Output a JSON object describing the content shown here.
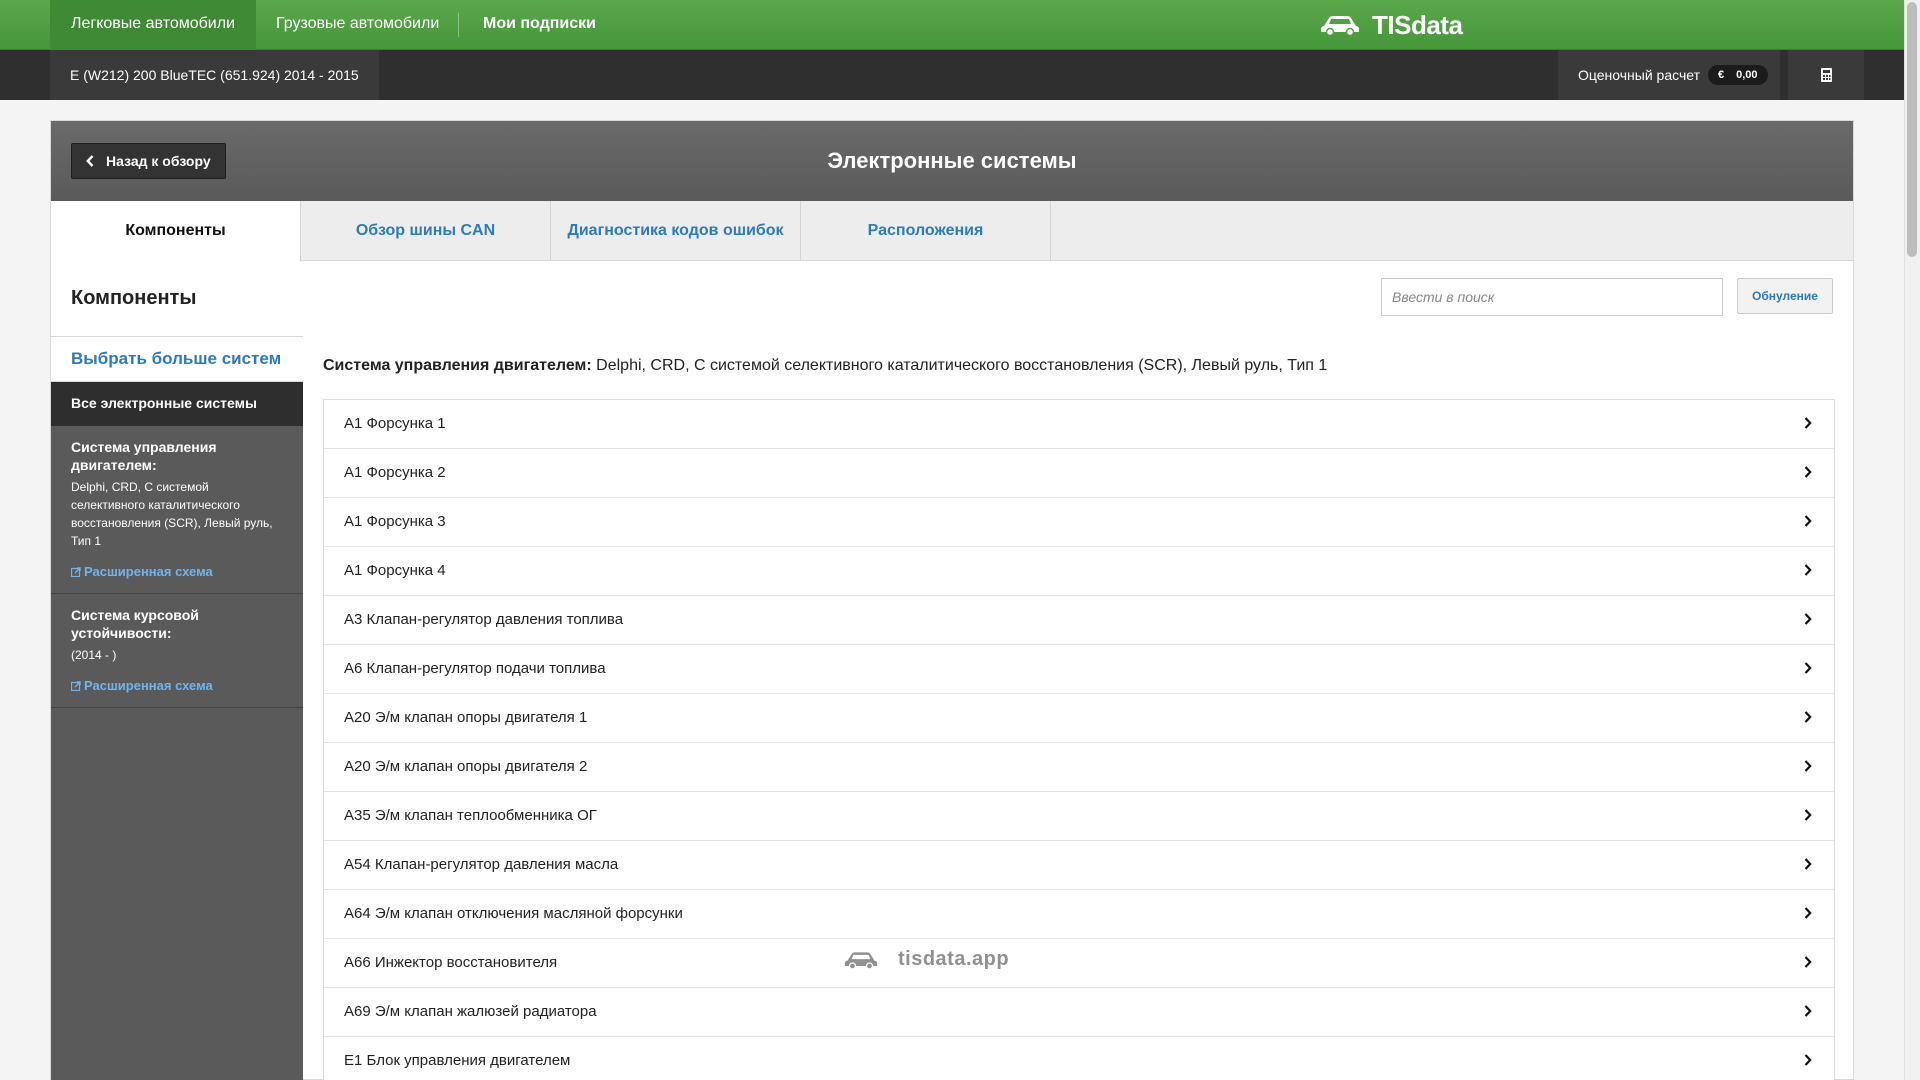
{
  "topnav": {
    "tabs": [
      {
        "label": "Легковые автомобили",
        "active": true
      },
      {
        "label": "Грузовые автомобили",
        "active": false
      },
      {
        "label": "Мои подписки",
        "active": false
      }
    ],
    "logo": "TISdata"
  },
  "vehicle_bar": {
    "vehicle": "E (W212) 200 BlueTEC (651.924) 2014 - 2015",
    "estimate_label": "Оценочный расчет",
    "currency": "€",
    "amount": "0,00",
    "calculator_icon": "calculator-icon"
  },
  "panel": {
    "back_label": "Назад к обзору",
    "title": "Электронные системы",
    "tabs": [
      {
        "label": "Компоненты",
        "active": true
      },
      {
        "label": "Обзор шины CAN",
        "active": false
      },
      {
        "label": "Диагностика кодов ошибок",
        "active": false
      },
      {
        "label": "Расположения",
        "active": false
      }
    ],
    "section_title": "Компоненты",
    "search_placeholder": "Ввести в поиск",
    "reset_label": "Обнуление"
  },
  "sidebar": {
    "more_label": "Выбрать больше систем",
    "all_label": "Все электронные системы",
    "systems": [
      {
        "heading": "Система управления двигателем:",
        "detail": "Delphi, CRD, С системой селективного каталитического восстановления (SCR), Левый руль, Тип 1",
        "link": "Расширенная схема"
      },
      {
        "heading": "Система курсовой устойчивости:",
        "detail": "(2014 - )",
        "link": "Расширенная схема"
      }
    ]
  },
  "content": {
    "system_label": "Система управления двигателем:",
    "system_detail": "Delphi, CRD, С системой селективного каталитического восстановления (SCR), Левый руль, Тип 1",
    "components": [
      "A1 Форсунка 1",
      "A1 Форсунка 2",
      "A1 Форсунка 3",
      "A1 Форсунка 4",
      "A3 Клапан-регулятор давления топлива",
      "A6 Клапан-регулятор подачи топлива",
      "A20 Э/м клапан опоры двигателя 1",
      "A20 Э/м клапан опоры двигателя 2",
      "A35 Э/м клапан теплообменника ОГ",
      "A54 Клапан-регулятор давления масла",
      "A64 Э/м клапан отключения масляной форсунки",
      "A66 Инжектор восстановителя",
      "A69 Э/м клапан жалюзей радиатора",
      "E1 Блок управления двигателем"
    ]
  },
  "watermark": "tisdata.app",
  "colors": {
    "brand_green": "#4fa043",
    "link_blue": "#2a7bbf",
    "header_gray": "#636363",
    "sidebar_gray": "#5a5a5a"
  }
}
